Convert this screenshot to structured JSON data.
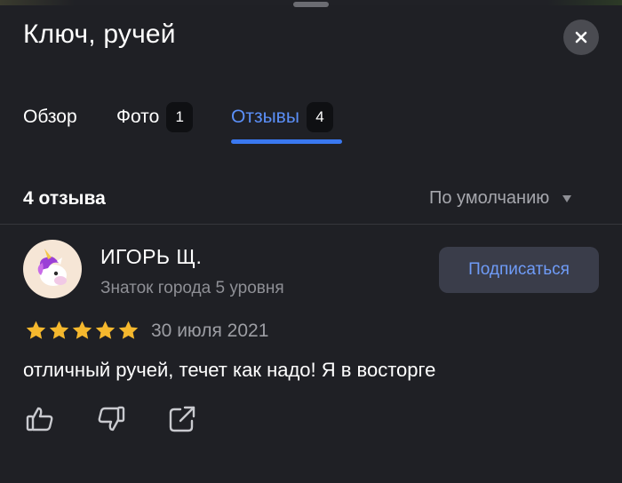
{
  "header": {
    "title": "Ключ, ручей",
    "close_icon": "close-icon"
  },
  "tabs": [
    {
      "label": "Обзор",
      "count": null,
      "active": false
    },
    {
      "label": "Фото",
      "count": "1",
      "active": false
    },
    {
      "label": "Отзывы",
      "count": "4",
      "active": true
    }
  ],
  "reviews": {
    "count_label": "4 отзыва",
    "sort_label": "По умолчанию",
    "sort_icon": "chevron-down-icon"
  },
  "review": {
    "author": "ИГОРЬ Щ.",
    "rank": "Знаток города 5 уровня",
    "subscribe_label": "Подписаться",
    "rating": 5,
    "date": "30 июля 2021",
    "text": "отличный ручей, течет как надо! Я в восторге",
    "avatar_icon": "unicorn-avatar"
  },
  "colors": {
    "background": "#1f2025",
    "accent": "#3a78f0",
    "star": "#f5b82e"
  }
}
